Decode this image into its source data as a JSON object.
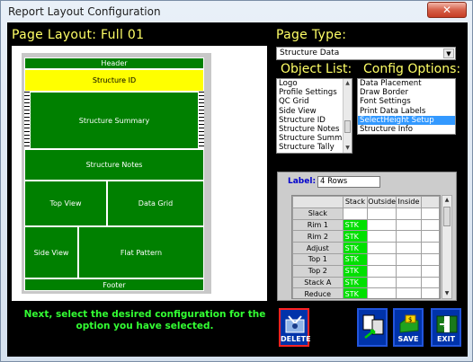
{
  "window": {
    "title": "Report Layout Configuration",
    "close_glyph": "✕"
  },
  "page_layout": {
    "title": "Page Layout: Full 01",
    "blocks": {
      "header": "Header",
      "structure_id": "Structure ID",
      "structure_summary": "Structure Summary",
      "structure_notes": "Structure Notes",
      "top_view": "Top View",
      "data_grid": "Data Grid",
      "side_view": "Side View",
      "flat_pattern": "Flat Pattern",
      "footer": "Footer"
    }
  },
  "page_type": {
    "title": "Page Type:",
    "selected": "Structure Data"
  },
  "object_list": {
    "title": "Object List:",
    "items": [
      "Logo",
      "Profile Settings",
      "QC Grid",
      "Side View",
      "Structure ID",
      "Structure Notes",
      "Structure Summar",
      "Structure Tally"
    ]
  },
  "config_options": {
    "title": "Config Options:",
    "items": [
      "Data Placement",
      "Draw Border",
      "Font Settings",
      "Print Data Labels",
      "SelectHeight Setup",
      "Structure Info"
    ],
    "selected_index": 4
  },
  "grid": {
    "label_caption": "Label:",
    "label_value": "4 Rows",
    "columns": [
      "",
      "Stack",
      "Outside",
      "Inside"
    ],
    "rows": [
      {
        "name": "Slack",
        "stack": ""
      },
      {
        "name": "Rim 1",
        "stack": "STK"
      },
      {
        "name": "Rim 2",
        "stack": "STK"
      },
      {
        "name": "Adjust",
        "stack": "STK"
      },
      {
        "name": "Top 1",
        "stack": "STK"
      },
      {
        "name": "Top 2",
        "stack": "STK"
      },
      {
        "name": "Stack A",
        "stack": "STK"
      },
      {
        "name": "Reduce",
        "stack": "STK"
      }
    ]
  },
  "hint": "Next, select the desired configuration for the option you have selected.",
  "buttons": {
    "delete": "DELETE",
    "save": "SAVE",
    "exit": "EXIT"
  },
  "colors": {
    "background": "#000000",
    "accent_yellow": "#ffff66",
    "green_block": "#008000",
    "hint_green": "#33ff33",
    "selection": "#3399ff"
  }
}
